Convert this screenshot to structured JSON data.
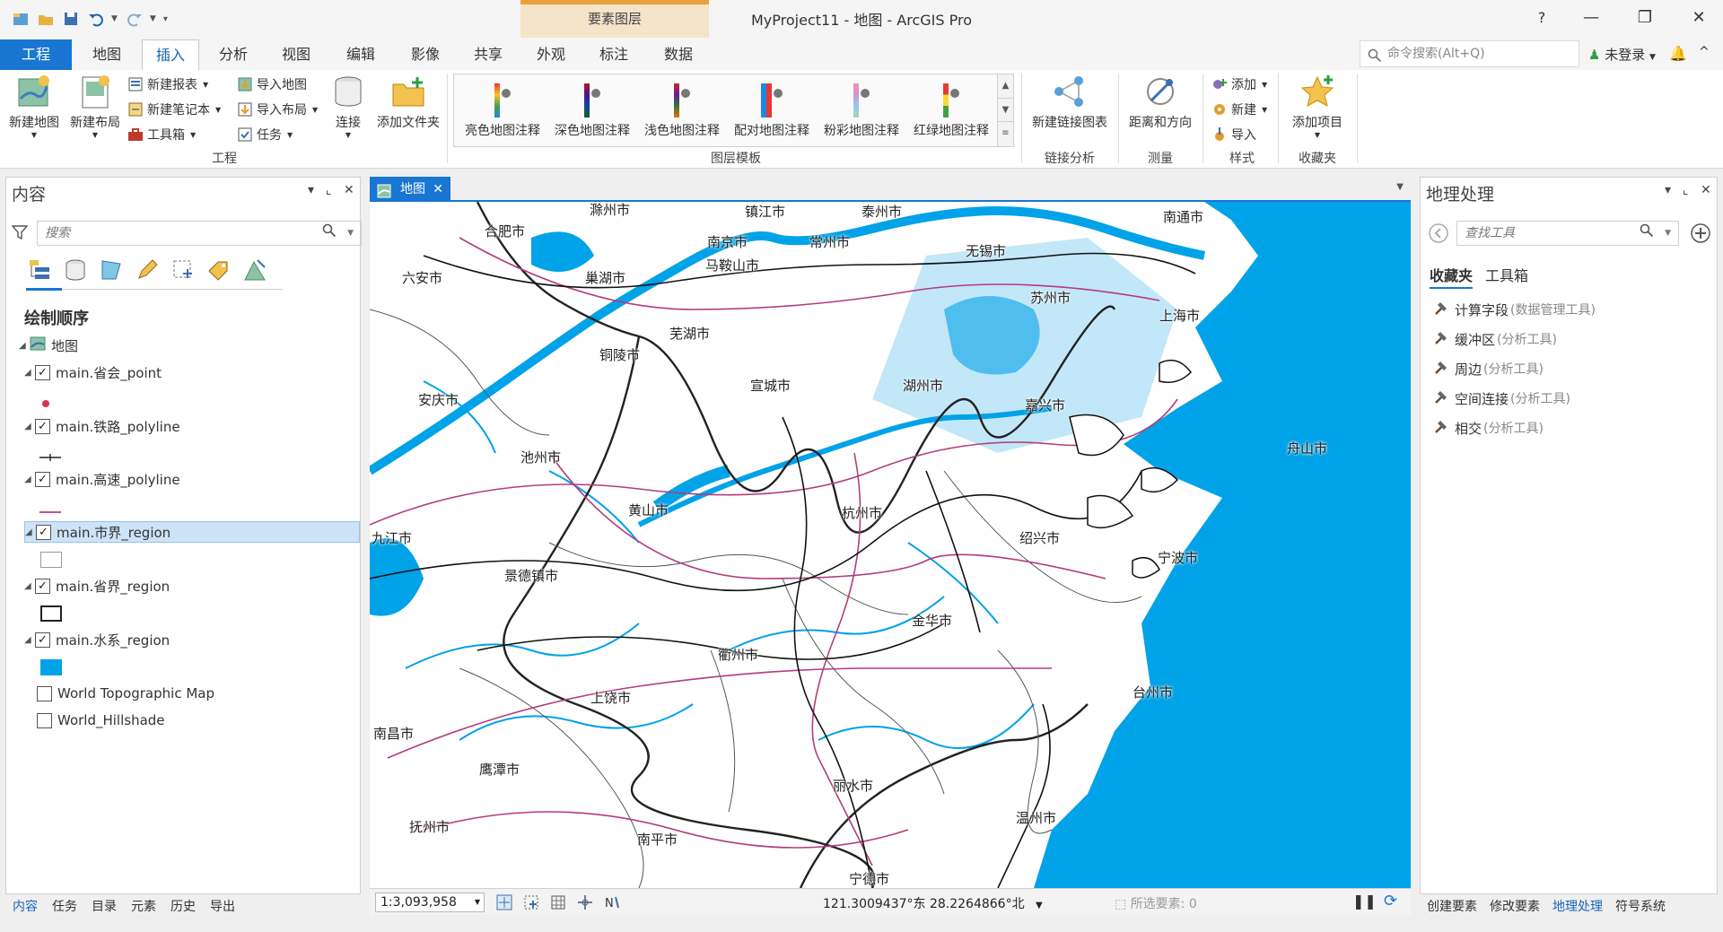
{
  "window": {
    "title": "MyProject11 - 地图 - ArcGIS Pro",
    "context_group": "要素图层",
    "help": "?",
    "minimize": "—",
    "restore": "❐",
    "close": "✕"
  },
  "tabs": [
    "工程",
    "地图",
    "插入",
    "分析",
    "视图",
    "编辑",
    "影像",
    "共享",
    "外观",
    "标注",
    "数据"
  ],
  "command_search": {
    "placeholder": "命令搜索(Alt+Q)"
  },
  "account": {
    "label": "未登录"
  },
  "ribbon": {
    "project_group": {
      "label": "工程",
      "new_map": "新建地图",
      "new_layout": "新建布局",
      "new_report": "新建报表",
      "new_notebook": "新建笔记本",
      "toolbox": "工具箱",
      "import_map": "导入地图",
      "import_layout": "导入布局",
      "task": "任务",
      "connect": "连接",
      "add_folder": "添加文件夹"
    },
    "layer_templates": {
      "label": "图层模板",
      "items": [
        "亮色地图注释",
        "深色地图注释",
        "浅色地图注释",
        "配对地图注释",
        "粉彩地图注释",
        "红绿地图注释"
      ]
    },
    "link_analysis": {
      "label": "链接分析",
      "new_link_chart": "新建链接图表"
    },
    "measure": {
      "label": "测量",
      "distance_direction": "距离和方向"
    },
    "styles": {
      "label": "样式",
      "add": "添加",
      "new": "新建",
      "import": "导入"
    },
    "favorites": {
      "label": "收藏夹",
      "add_item": "添加项目"
    }
  },
  "contents": {
    "title": "内容",
    "search_placeholder": "搜索",
    "drawing_order": "绘制顺序",
    "map_name": "地图",
    "layers": [
      {
        "name": "main.省会_point",
        "checked": "✓"
      },
      {
        "name": "main.铁路_polyline",
        "checked": "✓"
      },
      {
        "name": "main.高速_polyline",
        "checked": "✓"
      },
      {
        "name": "main.市界_region",
        "checked": "✓"
      },
      {
        "name": "main.省界_region",
        "checked": "✓"
      },
      {
        "name": "main.水系_region",
        "checked": "✓"
      },
      {
        "name": "World Topographic Map",
        "checked": ""
      },
      {
        "name": "World_Hillshade",
        "checked": ""
      }
    ],
    "bottom_tabs": [
      "内容",
      "任务",
      "目录",
      "元素",
      "历史",
      "导出"
    ]
  },
  "map_view": {
    "tab_label": "地图",
    "cities": [
      "滁州市",
      "镇江市",
      "泰州市",
      "南通市",
      "合肥市",
      "南京市",
      "常州市",
      "无锡市",
      "马鞍山市",
      "六安市",
      "巢湖市",
      "苏州市",
      "芜湖市",
      "上海市",
      "铜陵市",
      "宣城市",
      "湖州市",
      "安庆市",
      "嘉兴市",
      "池州市",
      "舟山市",
      "黄山市",
      "杭州市",
      "绍兴市",
      "九江市",
      "景德镇市",
      "宁波市",
      "金华市",
      "衢州市",
      "上饶市",
      "台州市",
      "南昌市",
      "鹰潭市",
      "丽水市",
      "温州市",
      "抚州市",
      "南平市",
      "宁德市"
    ],
    "scale": "1:3,093,958",
    "coordinates": "121.3009437°东 28.2264866°北",
    "selected_features": "所选要素: 0"
  },
  "geoprocessing": {
    "title": "地理处理",
    "search_placeholder": "查找工具",
    "tabs": [
      "收藏夹",
      "工具箱"
    ],
    "tools": [
      {
        "name": "计算字段",
        "toolbox": "(数据管理工具)"
      },
      {
        "name": "缓冲区",
        "toolbox": "(分析工具)"
      },
      {
        "name": "周边",
        "toolbox": "(分析工具)"
      },
      {
        "name": "空间连接",
        "toolbox": "(分析工具)"
      },
      {
        "name": "相交",
        "toolbox": "(分析工具)"
      }
    ],
    "bottom_tabs": [
      "创建要素",
      "修改要素",
      "地理处理",
      "符号系统"
    ]
  },
  "colors": {
    "accent": "#1976d2",
    "water": "#00a2e8",
    "context_tab": "#f4e4c8"
  }
}
